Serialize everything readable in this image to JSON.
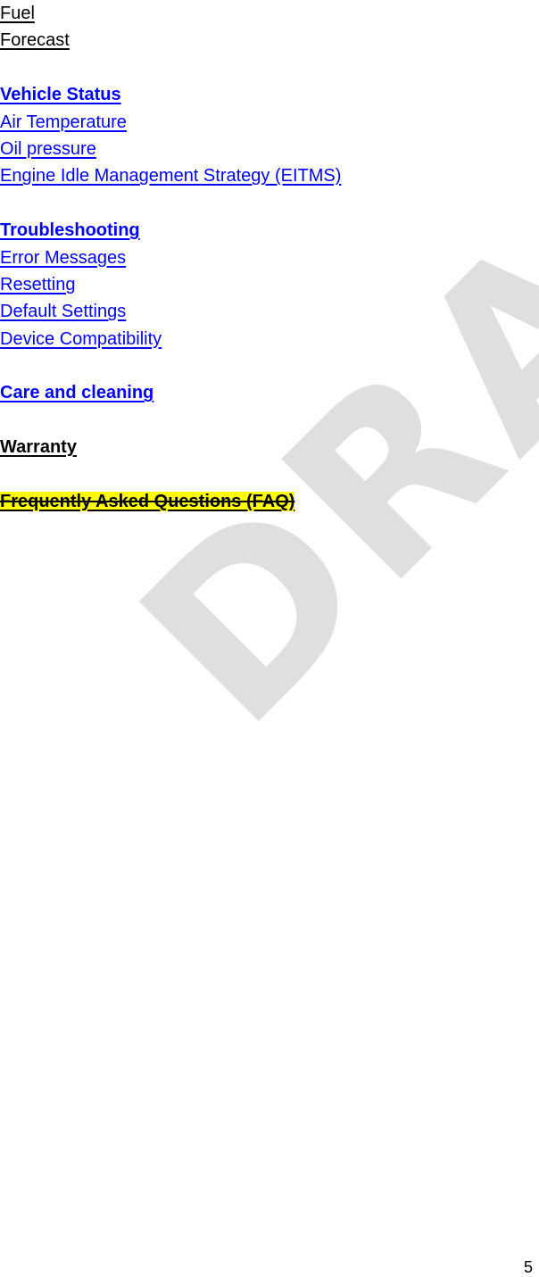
{
  "document": {
    "watermark": "DRAFT",
    "watermark_color": "#dfdfdf",
    "page_number": "5",
    "link_color": "#0000ff",
    "text_color": "#000000",
    "highlight_color": "#ffff00"
  },
  "toc": {
    "lines": [
      {
        "text": "Fuel",
        "style": "plain"
      },
      {
        "text": "Forecast",
        "style": "plain"
      },
      {
        "text": "",
        "style": "blank"
      },
      {
        "text": "Vehicle Status",
        "style": "link-bold"
      },
      {
        "text": "Air Temperature",
        "style": "link"
      },
      {
        "text": "Oil pressure",
        "style": "link"
      },
      {
        "text": "Engine Idle Management Strategy (EITMS)",
        "style": "link"
      },
      {
        "text": "",
        "style": "blank"
      },
      {
        "text": "Troubleshooting",
        "style": "link-bold"
      },
      {
        "text": "Error Messages",
        "style": "link"
      },
      {
        "text": "Resetting",
        "style": "link"
      },
      {
        "text": "Default Settings",
        "style": "link"
      },
      {
        "text": "Device Compatibility",
        "style": "link"
      },
      {
        "text": "",
        "style": "blank"
      },
      {
        "text": "Care and cleaning",
        "style": "link-bold"
      },
      {
        "text": "",
        "style": "blank"
      },
      {
        "text": "Warranty",
        "style": "plain-bold"
      },
      {
        "text": "",
        "style": "blank"
      },
      {
        "text": "Frequently Asked Questions (FAQ)",
        "style": "highlight-strike"
      }
    ]
  }
}
